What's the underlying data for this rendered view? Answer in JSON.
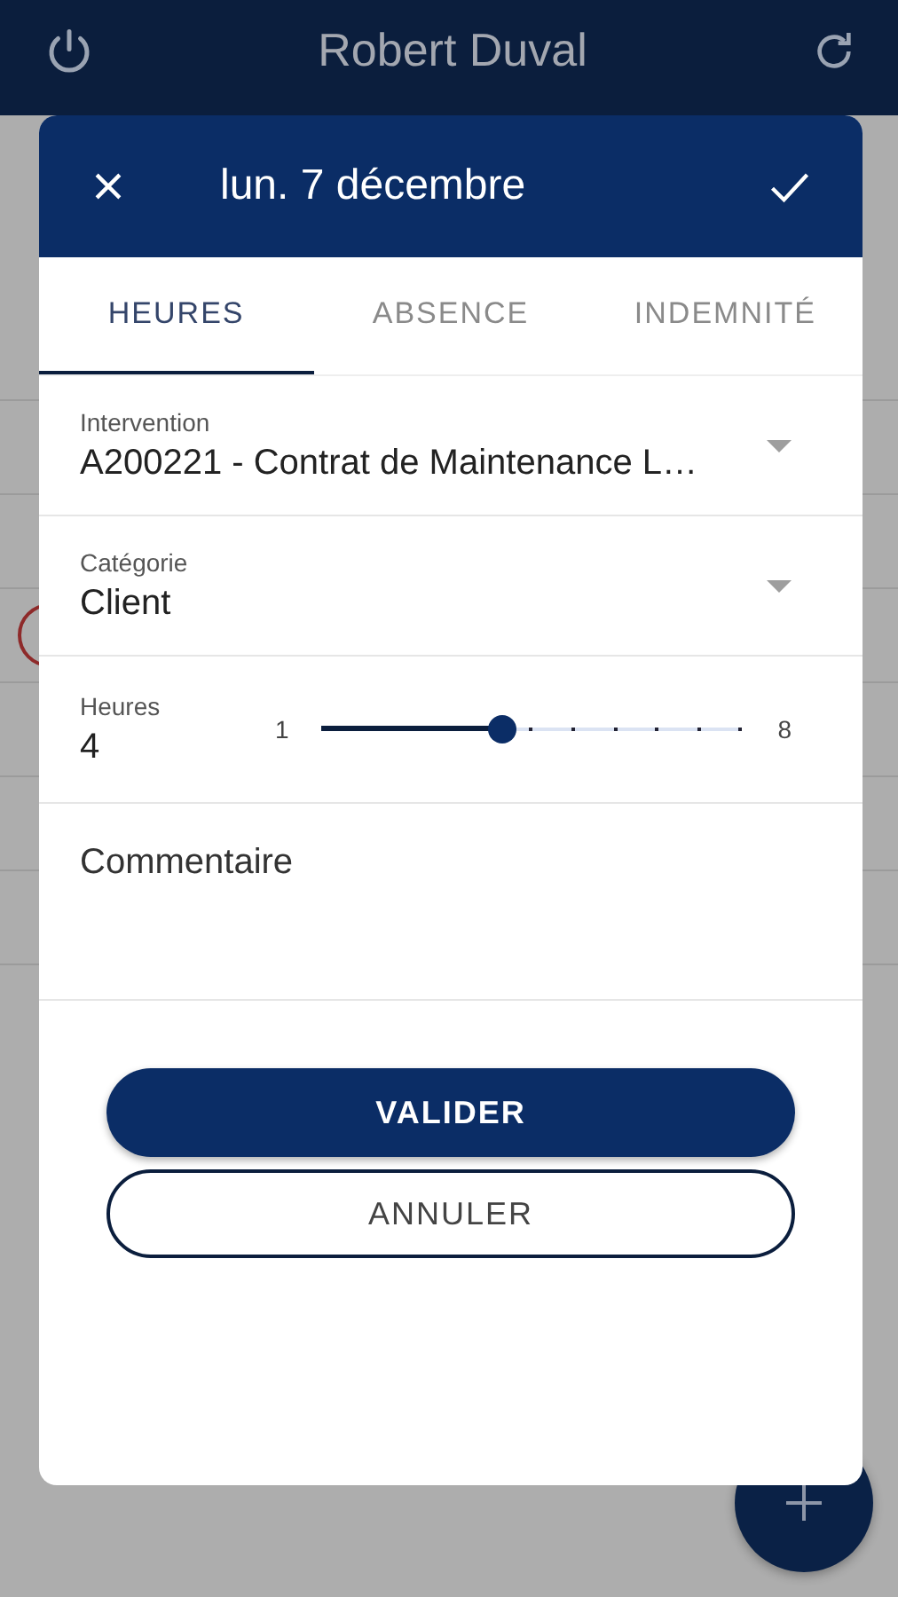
{
  "app_bar": {
    "title": "Robert Duval"
  },
  "dialog": {
    "title": "lun. 7 décembre",
    "tabs": [
      {
        "label": "HEURES",
        "selected": true
      },
      {
        "label": "ABSENCE",
        "selected": false
      },
      {
        "label": "INDEMNITÉ",
        "selected": false
      }
    ],
    "fields": [
      {
        "kind": "select",
        "label": "Intervention",
        "value": "A200221 - Contrat de Maintenance L…"
      },
      {
        "kind": "select",
        "label": "Catégorie",
        "value": "Client"
      },
      {
        "kind": "slider",
        "label": "Heures",
        "value": "4",
        "min": "1",
        "max": "8",
        "level": 0.4286
      },
      {
        "kind": "textarea",
        "placeholder": "Commentaire"
      }
    ],
    "buttons": [
      {
        "label": "VALIDER",
        "kind": "primary"
      },
      {
        "label": "ANNULER",
        "kind": "outline"
      }
    ]
  }
}
